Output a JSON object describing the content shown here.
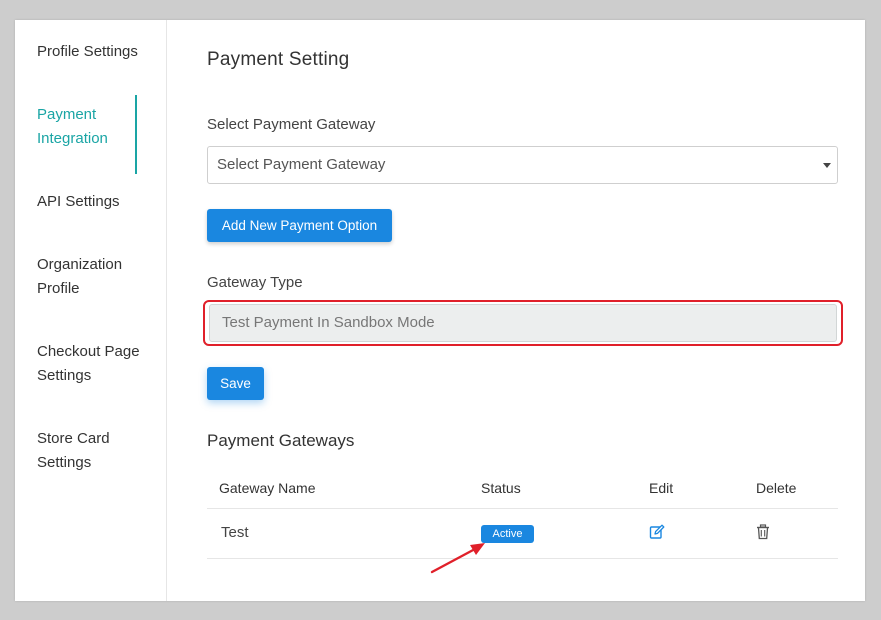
{
  "sidebar": {
    "items": [
      {
        "label": "Profile Settings"
      },
      {
        "label": "Payment Integration"
      },
      {
        "label": "API Settings"
      },
      {
        "label": "Organization Profile"
      },
      {
        "label": "Checkout Page Settings"
      },
      {
        "label": "Store Card Settings"
      }
    ],
    "active_index": 1
  },
  "main": {
    "title": "Payment Setting",
    "gateway_label": "Select Payment Gateway",
    "gateway_select_value": "Select Payment Gateway",
    "add_button": "Add New Payment Option",
    "gateway_type_label": "Gateway Type",
    "gateway_type_value": "Test Payment In Sandbox Mode",
    "save_button": "Save"
  },
  "gateways": {
    "title": "Payment Gateways",
    "columns": [
      "Gateway Name",
      "Status",
      "Edit",
      "Delete"
    ],
    "rows": [
      {
        "name": "Test",
        "status": "Active"
      }
    ]
  },
  "colors": {
    "accent": "#1aa5a5",
    "primary": "#1a87e0",
    "highlight": "#e0202a"
  },
  "icons": {
    "edit": "edit-icon",
    "delete": "trash-icon"
  }
}
